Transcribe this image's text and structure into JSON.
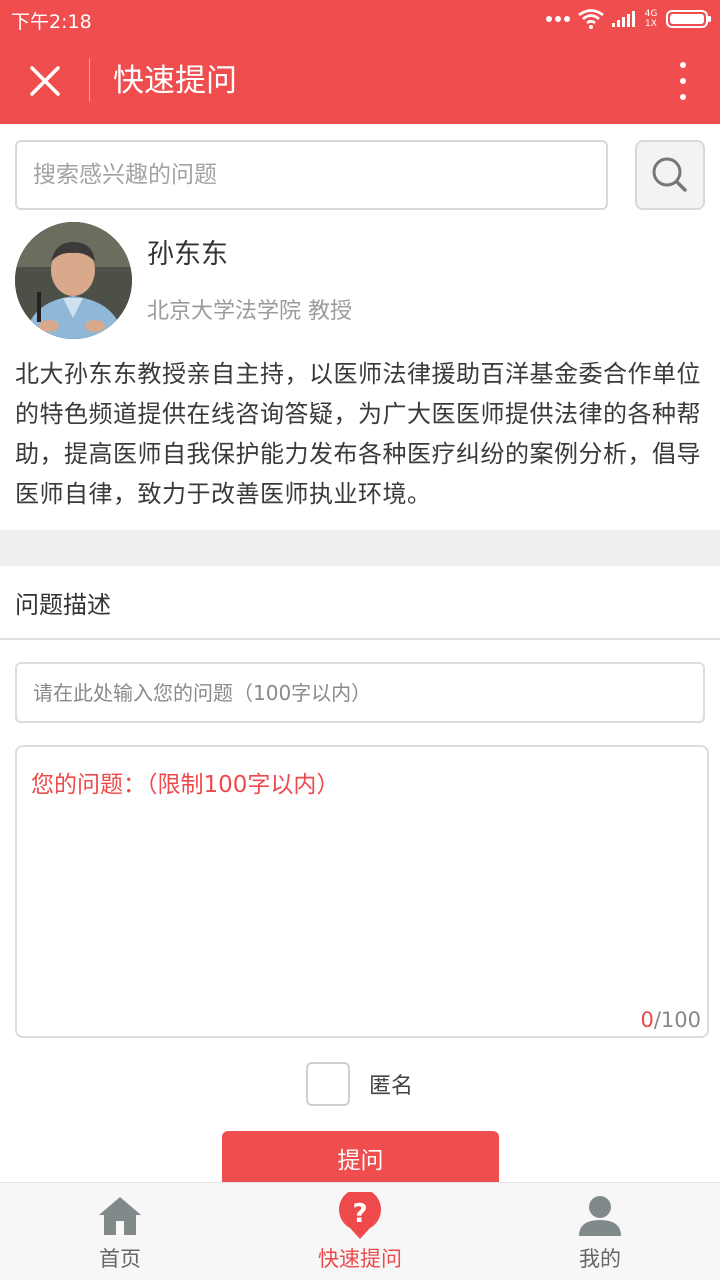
{
  "status_bar": {
    "time": "下午2:18",
    "network": "4G\n1X"
  },
  "app_bar": {
    "title": "快速提问",
    "close_icon": "close-icon",
    "more_icon": "more-vertical-icon"
  },
  "search": {
    "placeholder": "搜索感兴趣的问题",
    "button_icon": "search-icon"
  },
  "expert": {
    "name": "孙东东",
    "title": "北京大学法学院 教授",
    "introduction": "北大孙东东教授亲自主持，以医师法律援助百洋基金委合作单位的特色频道提供在线咨询答疑，为广大医医师提供法律的各种帮助，提高医师自我保护能力发布各种医疗纠纷的案例分析，倡导医师自律，致力于改善医师执业环境。"
  },
  "form": {
    "section_title": "问题描述",
    "title_placeholder": "请在此处输入您的问题（100字以内）",
    "body_placeholder": "您的问题：（限制100字以内）",
    "char_count_current": "0",
    "char_count_max": "/100",
    "anonymous_label": "匿名",
    "anonymous_checked": false,
    "submit_label": "提问"
  },
  "tab_bar": {
    "items": [
      {
        "label": "首页",
        "icon": "home-icon",
        "active": false
      },
      {
        "label": "快速提问",
        "icon": "question-pin-icon",
        "active": true
      },
      {
        "label": "我的",
        "icon": "user-icon",
        "active": false
      }
    ]
  },
  "colors": {
    "brand": "#f04d4f",
    "accent_text": "#ee4a4c",
    "inactive_icon": "#808a8a"
  }
}
